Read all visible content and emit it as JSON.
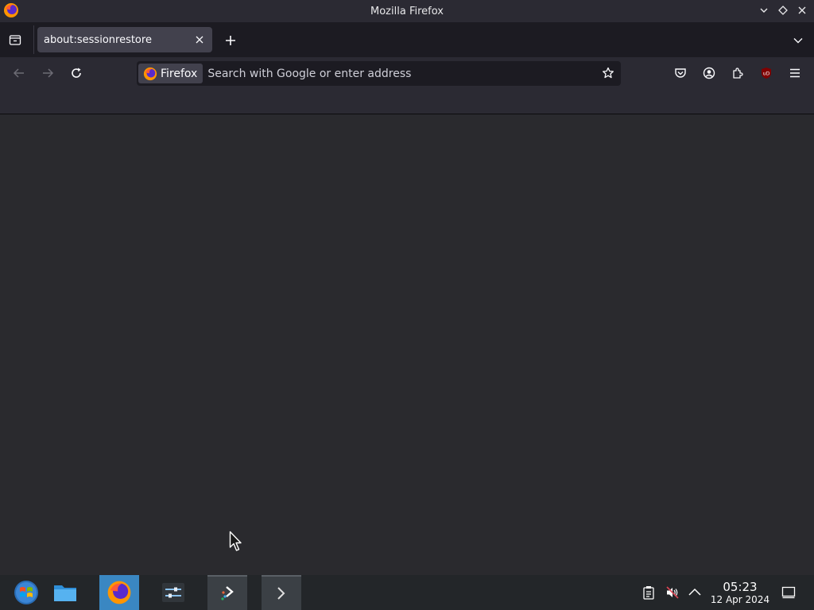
{
  "window": {
    "title": "Mozilla Firefox"
  },
  "tabs": [
    {
      "label": "about:sessionrestore"
    }
  ],
  "urlbar": {
    "identity_label": "Firefox",
    "placeholder": "Search with Google or enter address",
    "value": ""
  },
  "taskbar": {
    "apps": [
      {
        "name": "start-menu"
      },
      {
        "name": "file-manager"
      },
      {
        "name": "firefox",
        "state": "active"
      },
      {
        "name": "system-settings"
      },
      {
        "name": "discover"
      },
      {
        "name": "terminal",
        "state": "open"
      }
    ],
    "clock": {
      "time": "05:23",
      "date": "12 Apr 2024"
    }
  },
  "colors": {
    "accent": "#3a87c2",
    "chrome": "#2b2a33",
    "content": "#2a2a2e",
    "taskbar": "#232629"
  }
}
